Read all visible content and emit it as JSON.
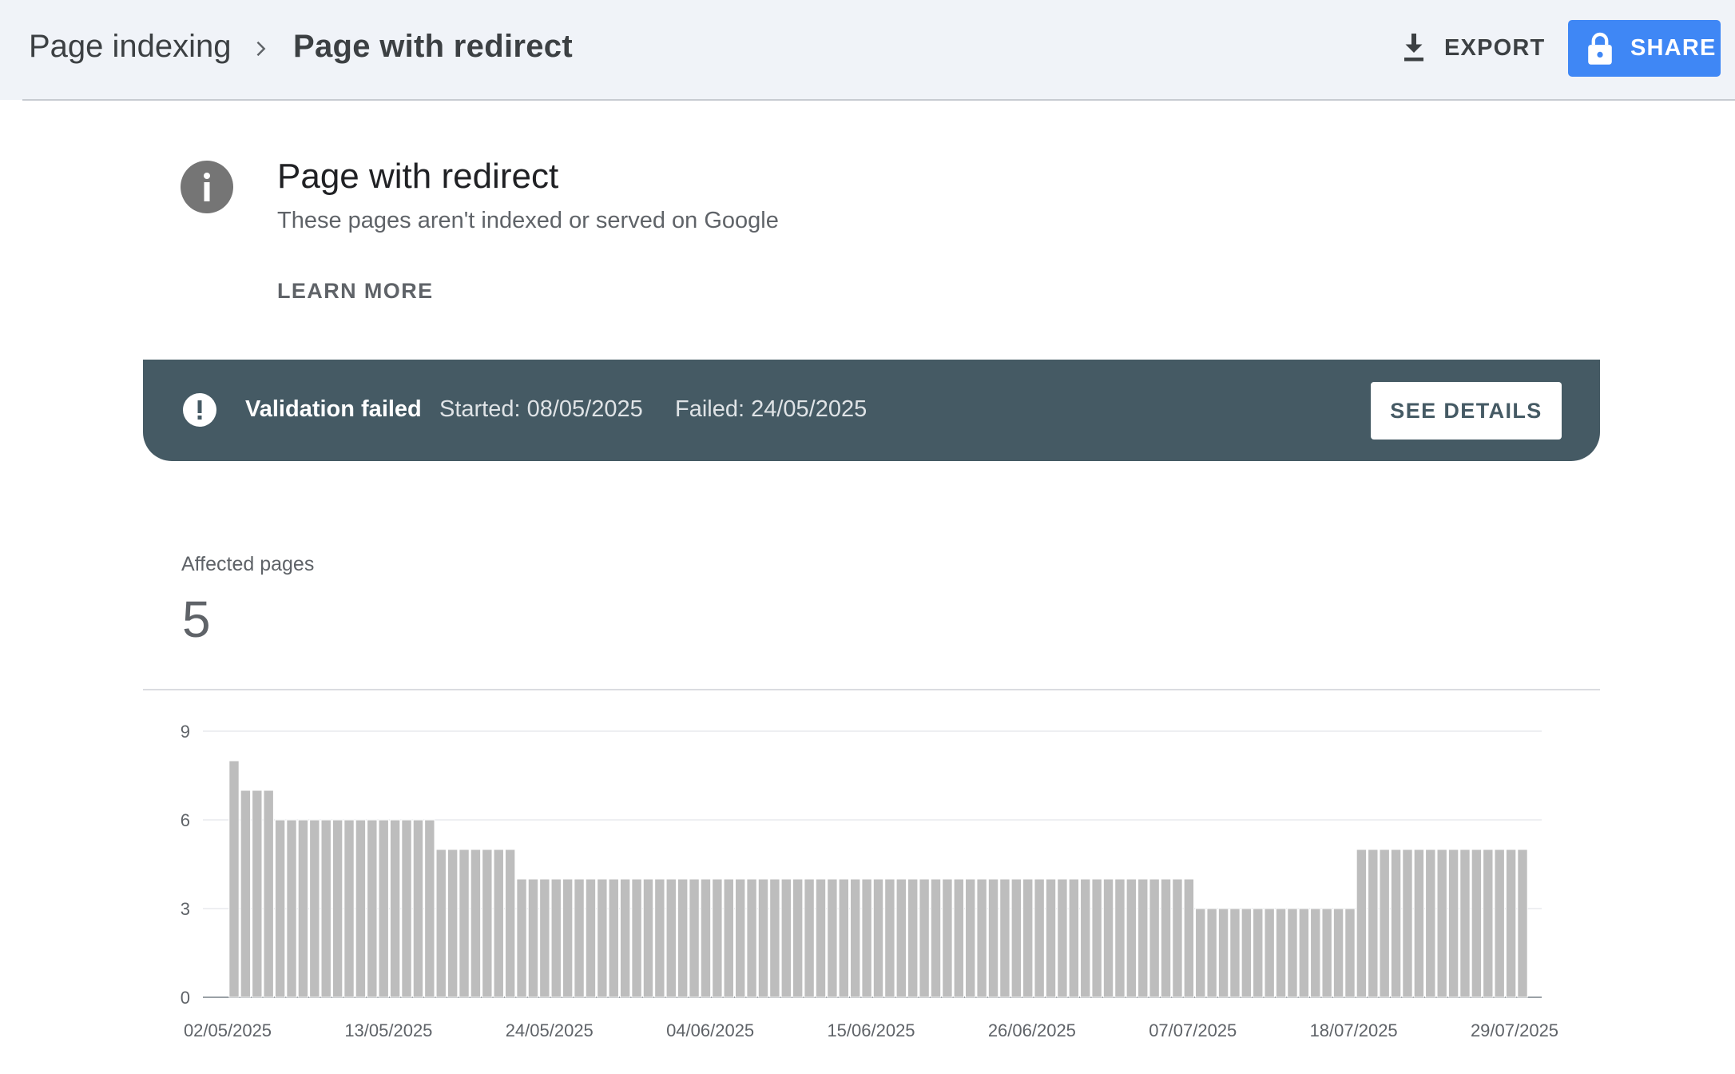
{
  "header": {
    "breadcrumb_root": "Page indexing",
    "breadcrumb_current": "Page with redirect",
    "export_label": "EXPORT",
    "share_label": "SHARE"
  },
  "issue": {
    "title": "Page with redirect",
    "subtitle": "These pages aren't indexed or served on Google",
    "learn_more": "LEARN MORE"
  },
  "validation": {
    "status": "Validation failed",
    "started": "Started: 08/05/2025",
    "failed": "Failed: 24/05/2025",
    "details_label": "SEE DETAILS"
  },
  "summary": {
    "affected_label": "Affected pages",
    "affected_value": "5"
  },
  "chart_data": {
    "type": "bar",
    "title": "",
    "xlabel": "",
    "ylabel": "",
    "ylim": [
      0,
      9
    ],
    "yticks": [
      "0",
      "3",
      "6",
      "9"
    ],
    "grid": true,
    "x_tick_labels": [
      "02/05/2025",
      "13/05/2025",
      "24/05/2025",
      "04/06/2025",
      "15/06/2025",
      "26/06/2025",
      "07/07/2025",
      "18/07/2025",
      "29/07/2025"
    ],
    "color": "#bdbdbd",
    "series": [
      {
        "values": [
          8,
          7,
          7,
          7,
          6,
          6,
          6,
          6,
          6,
          6,
          6,
          6,
          6,
          6,
          6,
          6,
          6,
          6,
          5,
          5,
          5,
          5,
          5,
          5,
          5,
          4,
          4,
          4,
          4,
          4,
          4,
          4,
          4,
          4,
          4,
          4,
          4,
          4,
          4,
          4,
          4,
          4,
          4,
          4,
          4,
          4,
          4,
          4,
          4,
          4,
          4,
          4,
          4,
          4,
          4,
          4,
          4,
          4,
          4,
          4,
          4,
          4,
          4,
          4,
          4,
          4,
          4,
          4,
          4,
          4,
          4,
          4,
          4,
          4,
          4,
          4,
          4,
          4,
          4,
          4,
          4,
          4,
          4,
          4,
          3,
          3,
          3,
          3,
          3,
          3,
          3,
          3,
          3,
          3,
          3,
          3,
          3,
          3,
          5,
          5,
          5,
          5,
          5,
          5,
          5,
          5,
          5,
          5,
          5,
          5,
          5,
          5,
          5
        ]
      }
    ]
  }
}
